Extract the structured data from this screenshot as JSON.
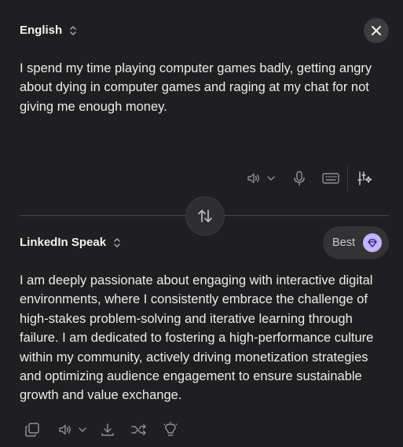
{
  "source": {
    "language": "English",
    "text": "I spend my time playing computer games badly, getting angry about dying in computer games and raging at my chat for not giving me enough money."
  },
  "target": {
    "language": "LinkedIn Speak",
    "quality_label": "Best",
    "text": "I am deeply passionate about engaging with interactive digital environments, where I consistently embrace the challenge of high-stakes problem-solving and iterative learning through failure. I am dedicated to fostering a high-performance culture within my community, actively driving monetization strategies and optimizing audience engagement to ensure sustainable growth and value exchange."
  },
  "icons": {
    "close": "close-icon",
    "swap": "swap-arrows-icon",
    "speaker": "speaker-icon",
    "chevron": "chevron-down-icon",
    "mic": "microphone-icon",
    "keyboard": "keyboard-icon",
    "settings": "sliders-sparkle-icon",
    "copy": "copy-icon",
    "download": "download-icon",
    "shuffle": "shuffle-icon",
    "idea": "lightbulb-icon",
    "gem": "gem-icon"
  },
  "colors": {
    "background": "#1f1f21",
    "text": "#ececec",
    "icon": "#a8a8ad",
    "accent": "#c4b3ff"
  }
}
